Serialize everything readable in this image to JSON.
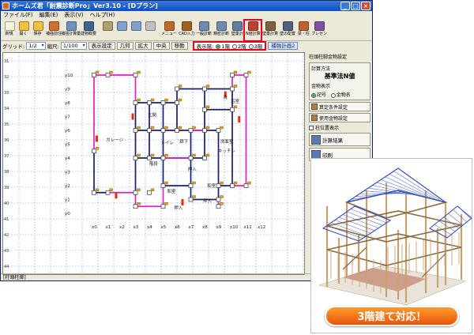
{
  "window": {
    "title": "ホームズ君「耐震診断Pro」Ver3.10 - [Dプラン]",
    "buttons": [
      "_",
      "□",
      "×"
    ]
  },
  "menu": [
    "ファイル(F)",
    "編集(E)",
    "表示(V)",
    "ヘルプ(H)"
  ],
  "toolbar": [
    {
      "label": "新規",
      "icon": "new-file-icon",
      "color": "#f7f3d6"
    },
    {
      "label": "開く",
      "icon": "open-folder-icon",
      "color": "#f0c040"
    },
    {
      "label": "保存",
      "icon": "save-icon",
      "color": "#f0c040"
    },
    {
      "label": "補強前住",
      "icon": "house-before-icon",
      "color": "#d07030"
    },
    {
      "label": "補強計算量",
      "icon": "calc-icon",
      "color": "#7090c0"
    },
    {
      "label": "建物概要",
      "icon": "building-info-icon",
      "color": "#406090"
    },
    {
      "label": "",
      "icon": "pen-icon",
      "color": "#b0a070"
    },
    {
      "label": "",
      "icon": "undo-icon",
      "color": "#80a0d0"
    },
    {
      "label": "",
      "icon": "redo-icon",
      "color": "#80a0d0"
    },
    {
      "label": "",
      "icon": "dimension-icon",
      "color": "#c0c0c0"
    },
    {
      "label": "メニュー",
      "icon": "menu-icon",
      "color": "#c06a2a"
    },
    {
      "label": "CAD入力",
      "icon": "cad-icon",
      "color": "#a06020"
    },
    {
      "label": "一般診断",
      "icon": "general-diag-icon",
      "color": "#708bb0"
    },
    {
      "label": "精密診断",
      "icon": "precise-diag-icon",
      "color": "#708bb0"
    },
    {
      "label": "壁量計",
      "icon": "wall-meter-icon",
      "color": "#6080a0"
    },
    {
      "label": "N値計算",
      "icon": "n-value-icon",
      "color": "#c04030"
    },
    {
      "label": "壁量計算",
      "icon": "wall-calc-icon",
      "color": "#806040"
    },
    {
      "label": "壁の配置",
      "icon": "wall-layout-icon",
      "color": "#506080"
    },
    {
      "label": "梁・柱",
      "icon": "beam-column-icon",
      "color": "#c06030"
    },
    {
      "label": "プレゼン",
      "icon": "presentation-icon",
      "color": "#8050a0"
    }
  ],
  "options": {
    "grid_label": "グリッド:",
    "grid_value": "1/2",
    "scale_label": "縮尺:",
    "scale_value": "1/100",
    "display_settings": "表示設定",
    "fit": "几何",
    "zoom": "拡大",
    "center": "中央",
    "move": "移動",
    "floor_label": "表示階:",
    "floors": [
      "1階",
      "2階",
      "3階"
    ],
    "selected_floor": "1階",
    "reinforce_plan": "補強計画2"
  },
  "canvas": {
    "y_labels": [
      "y10",
      "y9",
      "y8",
      "y7",
      "y6",
      "y5",
      "y4",
      "y3",
      "y2",
      "y1",
      "y0"
    ],
    "x_labels": [
      "x0",
      "x1",
      "x2",
      "x3",
      "x4",
      "x5",
      "x6",
      "x7",
      "x8",
      "x9",
      "x10",
      "x11",
      "x12"
    ],
    "row_numbers": [
      "31",
      "32",
      "33",
      "34",
      "35",
      "36",
      "37",
      "38",
      "39",
      "40",
      "41",
      "42",
      "43",
      "44"
    ],
    "rooms": [
      "ガレージ",
      "玄関",
      "トイレ",
      "階段",
      "廊下",
      "浴室",
      "洗面室",
      "キッチン",
      "押入",
      "和室",
      "和室",
      "押入",
      "洗",
      "押入"
    ]
  },
  "status": "[柱頭柱脚]",
  "panel": {
    "header": "柱頭柱脚金物設定",
    "method_label": "計算方法",
    "method_value": "基準法N値",
    "hardware_label": "金物表示",
    "hardware_options": [
      "記号",
      "金物名"
    ],
    "buttons": [
      "算定条件設定",
      "使用金物設定"
    ],
    "check_label": "柱位置表示",
    "result_button": "計算結果",
    "print_button": "印刷"
  },
  "promo": {
    "banner": "3階建て対応！"
  },
  "colors": {
    "accent_red": "#e8001c",
    "wall_navy": "#1a1f6b",
    "wall_magenta": "#e020c0",
    "grid_blue": "#3f6fd8",
    "banner_orange": "#f27a18"
  }
}
